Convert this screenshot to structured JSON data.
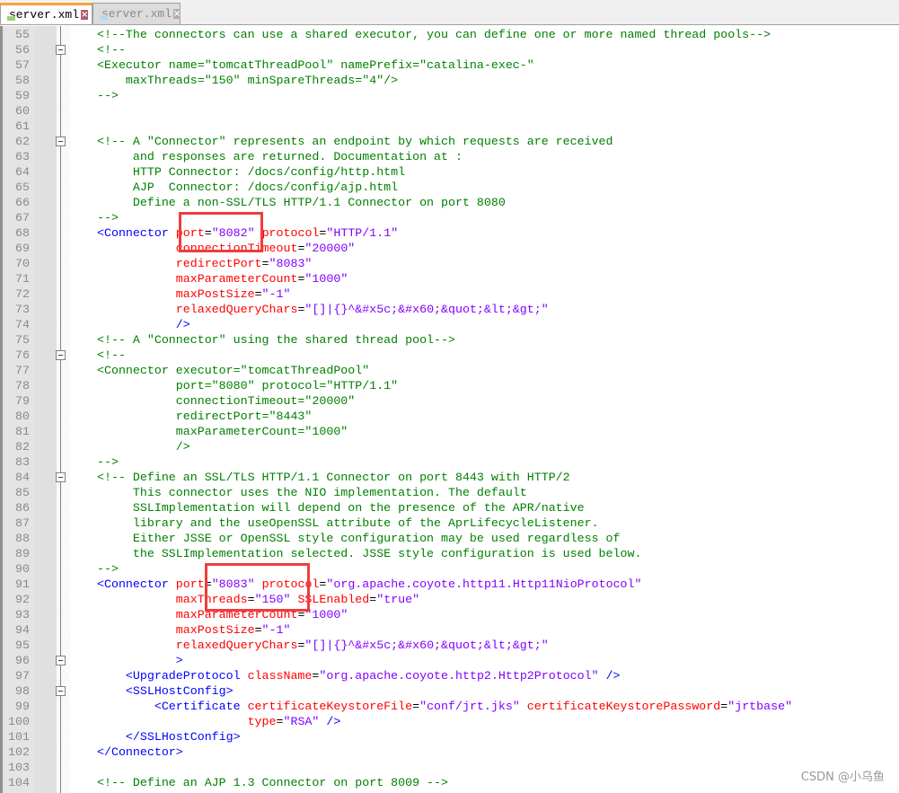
{
  "tabs": [
    {
      "label": "server.xml",
      "active": true
    },
    {
      "label": "server.xml",
      "active": false
    }
  ],
  "watermark": "CSDN @小乌鱼",
  "highlight_color": "#f03c3c",
  "editor": {
    "folds": [
      56,
      62,
      76,
      84,
      96,
      98
    ],
    "lines": [
      {
        "n": "55",
        "s": [
          [
            "c",
            "<!--The connectors can use a shared executor, you can define one or more named thread pools-->"
          ]
        ]
      },
      {
        "n": "56",
        "s": [
          [
            "c",
            "<!--"
          ]
        ]
      },
      {
        "n": "57",
        "s": [
          [
            "c",
            "<Executor name=\"tomcatThreadPool\" namePrefix=\"catalina-exec-\""
          ]
        ]
      },
      {
        "n": "58",
        "s": [
          [
            "c",
            "    maxThreads=\"150\" minSpareThreads=\"4\"/>"
          ]
        ]
      },
      {
        "n": "59",
        "s": [
          [
            "c",
            "-->"
          ]
        ]
      },
      {
        "n": "60",
        "s": []
      },
      {
        "n": "61",
        "s": []
      },
      {
        "n": "62",
        "s": [
          [
            "c",
            "<!-- A \"Connector\" represents an endpoint by which requests are received"
          ]
        ]
      },
      {
        "n": "63",
        "s": [
          [
            "c",
            "     and responses are returned. Documentation at :"
          ]
        ]
      },
      {
        "n": "64",
        "s": [
          [
            "c",
            "     HTTP Connector: /docs/config/http.html"
          ]
        ]
      },
      {
        "n": "65",
        "s": [
          [
            "c",
            "     AJP  Connector: /docs/config/ajp.html"
          ]
        ]
      },
      {
        "n": "66",
        "s": [
          [
            "c",
            "     Define a non-SSL/TLS HTTP/1.1 Connector on port 8080"
          ]
        ]
      },
      {
        "n": "67",
        "s": [
          [
            "c",
            "-->"
          ]
        ]
      },
      {
        "n": "68",
        "s": [
          [
            "t",
            "<Connector "
          ],
          [
            "a",
            "port"
          ],
          [
            "e",
            "="
          ],
          [
            "v",
            "\"8082\""
          ],
          [
            "e",
            " "
          ],
          [
            "a",
            "protocol"
          ],
          [
            "e",
            "="
          ],
          [
            "v",
            "\"HTTP/1.1\""
          ]
        ]
      },
      {
        "n": "69",
        "s": [
          [
            "e",
            "           "
          ],
          [
            "a",
            "connectionTimeout"
          ],
          [
            "e",
            "="
          ],
          [
            "v",
            "\"20000\""
          ]
        ]
      },
      {
        "n": "70",
        "s": [
          [
            "e",
            "           "
          ],
          [
            "a",
            "redirectPort"
          ],
          [
            "e",
            "="
          ],
          [
            "v",
            "\"8083\""
          ]
        ]
      },
      {
        "n": "71",
        "s": [
          [
            "e",
            "           "
          ],
          [
            "a",
            "maxParameterCount"
          ],
          [
            "e",
            "="
          ],
          [
            "v",
            "\"1000\""
          ]
        ]
      },
      {
        "n": "72",
        "s": [
          [
            "e",
            "           "
          ],
          [
            "a",
            "maxPostSize"
          ],
          [
            "e",
            "="
          ],
          [
            "v",
            "\"-1\""
          ]
        ]
      },
      {
        "n": "73",
        "s": [
          [
            "e",
            "           "
          ],
          [
            "a",
            "relaxedQueryChars"
          ],
          [
            "e",
            "="
          ],
          [
            "v",
            "\"[]|{}^&#x5c;&#x60;&quot;&lt;&gt;\""
          ]
        ]
      },
      {
        "n": "74",
        "s": [
          [
            "e",
            "           "
          ],
          [
            "t",
            "/>"
          ]
        ]
      },
      {
        "n": "75",
        "s": [
          [
            "c",
            "<!-- A \"Connector\" using the shared thread pool-->"
          ]
        ]
      },
      {
        "n": "76",
        "s": [
          [
            "c",
            "<!--"
          ]
        ]
      },
      {
        "n": "77",
        "s": [
          [
            "c",
            "<Connector executor=\"tomcatThreadPool\""
          ]
        ]
      },
      {
        "n": "78",
        "s": [
          [
            "c",
            "           port=\"8080\" protocol=\"HTTP/1.1\""
          ]
        ]
      },
      {
        "n": "79",
        "s": [
          [
            "c",
            "           connectionTimeout=\"20000\""
          ]
        ]
      },
      {
        "n": "80",
        "s": [
          [
            "c",
            "           redirectPort=\"8443\""
          ]
        ]
      },
      {
        "n": "81",
        "s": [
          [
            "c",
            "           maxParameterCount=\"1000\""
          ]
        ]
      },
      {
        "n": "82",
        "s": [
          [
            "c",
            "           />"
          ]
        ]
      },
      {
        "n": "83",
        "s": [
          [
            "c",
            "-->"
          ]
        ]
      },
      {
        "n": "84",
        "s": [
          [
            "c",
            "<!-- Define an SSL/TLS HTTP/1.1 Connector on port 8443 with HTTP/2"
          ]
        ]
      },
      {
        "n": "85",
        "s": [
          [
            "c",
            "     This connector uses the NIO implementation. The default"
          ]
        ]
      },
      {
        "n": "86",
        "s": [
          [
            "c",
            "     SSLImplementation will depend on the presence of the APR/native"
          ]
        ]
      },
      {
        "n": "87",
        "s": [
          [
            "c",
            "     library and the useOpenSSL attribute of the AprLifecycleListener."
          ]
        ]
      },
      {
        "n": "88",
        "s": [
          [
            "c",
            "     Either JSSE or OpenSSL style configuration may be used regardless of"
          ]
        ]
      },
      {
        "n": "89",
        "s": [
          [
            "c",
            "     the SSLImplementation selected. JSSE style configuration is used below."
          ]
        ]
      },
      {
        "n": "90",
        "s": [
          [
            "c",
            "-->"
          ]
        ]
      },
      {
        "n": "91",
        "s": [
          [
            "t",
            "<Connector "
          ],
          [
            "a",
            "port"
          ],
          [
            "e",
            "="
          ],
          [
            "v",
            "\"8083\""
          ],
          [
            "e",
            " "
          ],
          [
            "a",
            "protocol"
          ],
          [
            "e",
            "="
          ],
          [
            "v",
            "\"org.apache.coyote.http11.Http11NioProtocol\""
          ]
        ]
      },
      {
        "n": "92",
        "s": [
          [
            "e",
            "           "
          ],
          [
            "a",
            "maxThreads"
          ],
          [
            "e",
            "="
          ],
          [
            "v",
            "\"150\""
          ],
          [
            "e",
            " "
          ],
          [
            "a",
            "SSLEnabled"
          ],
          [
            "e",
            "="
          ],
          [
            "v",
            "\"true\""
          ]
        ]
      },
      {
        "n": "93",
        "s": [
          [
            "e",
            "           "
          ],
          [
            "a",
            "maxParameterCount"
          ],
          [
            "e",
            "="
          ],
          [
            "v",
            "\"1000\""
          ]
        ]
      },
      {
        "n": "94",
        "s": [
          [
            "e",
            "           "
          ],
          [
            "a",
            "maxPostSize"
          ],
          [
            "e",
            "="
          ],
          [
            "v",
            "\"-1\""
          ]
        ]
      },
      {
        "n": "95",
        "s": [
          [
            "e",
            "           "
          ],
          [
            "a",
            "relaxedQueryChars"
          ],
          [
            "e",
            "="
          ],
          [
            "v",
            "\"[]|{}^&#x5c;&#x60;&quot;&lt;&gt;\""
          ]
        ]
      },
      {
        "n": "96",
        "s": [
          [
            "e",
            "           "
          ],
          [
            "t",
            ">"
          ]
        ]
      },
      {
        "n": "97",
        "s": [
          [
            "e",
            "    "
          ],
          [
            "t",
            "<UpgradeProtocol "
          ],
          [
            "a",
            "className"
          ],
          [
            "e",
            "="
          ],
          [
            "v",
            "\"org.apache.coyote.http2.Http2Protocol\""
          ],
          [
            "e",
            " "
          ],
          [
            "t",
            "/>"
          ]
        ]
      },
      {
        "n": "98",
        "s": [
          [
            "e",
            "    "
          ],
          [
            "t",
            "<SSLHostConfig>"
          ]
        ]
      },
      {
        "n": "99",
        "s": [
          [
            "e",
            "        "
          ],
          [
            "t",
            "<Certificate "
          ],
          [
            "a",
            "certificateKeystoreFile"
          ],
          [
            "e",
            "="
          ],
          [
            "v",
            "\"conf/jrt.jks\""
          ],
          [
            "e",
            " "
          ],
          [
            "a",
            "certificateKeystorePassword"
          ],
          [
            "e",
            "="
          ],
          [
            "v",
            "\"jrtbase\""
          ]
        ]
      },
      {
        "n": "100",
        "s": [
          [
            "e",
            "                     "
          ],
          [
            "a",
            "type"
          ],
          [
            "e",
            "="
          ],
          [
            "v",
            "\"RSA\""
          ],
          [
            "e",
            " "
          ],
          [
            "t",
            "/>"
          ]
        ]
      },
      {
        "n": "101",
        "s": [
          [
            "e",
            "    "
          ],
          [
            "t",
            "</SSLHostConfig>"
          ]
        ]
      },
      {
        "n": "102",
        "s": [
          [
            "t",
            "</Connector>"
          ]
        ]
      },
      {
        "n": "103",
        "s": []
      },
      {
        "n": "104",
        "s": [
          [
            "c",
            "<!-- Define an AJP 1.3 Connector on port 8009 -->"
          ]
        ]
      }
    ]
  }
}
